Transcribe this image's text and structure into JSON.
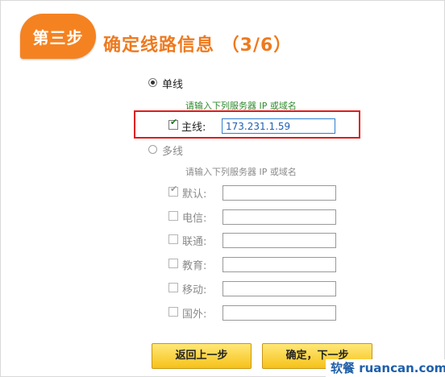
{
  "header": {
    "step_badge": "第三步",
    "title": "确定线路信息 （3/6）"
  },
  "single_line": {
    "radio_label": "单线",
    "hint": "请输入下列服务器 IP 或域名",
    "main_label": "主线:",
    "main_value": "173.231.1.59"
  },
  "multi_line": {
    "radio_label": "多线",
    "hint": "请输入下列服务器 IP 或域名",
    "lines": [
      {
        "label": "默认:",
        "checked": true
      },
      {
        "label": "电信:",
        "checked": false
      },
      {
        "label": "联通:",
        "checked": false
      },
      {
        "label": "教育:",
        "checked": false
      },
      {
        "label": "移动:",
        "checked": false
      },
      {
        "label": "国外:",
        "checked": false
      }
    ]
  },
  "buttons": {
    "back": "返回上一步",
    "next": "确定，下一步"
  },
  "watermark": "软餐 ruancan.com",
  "colors": {
    "accent": "#f58220",
    "title": "#ee7a1f",
    "hint_green": "#2e8b2e",
    "highlight": "#e01b1b",
    "button": "#f6c21a"
  }
}
